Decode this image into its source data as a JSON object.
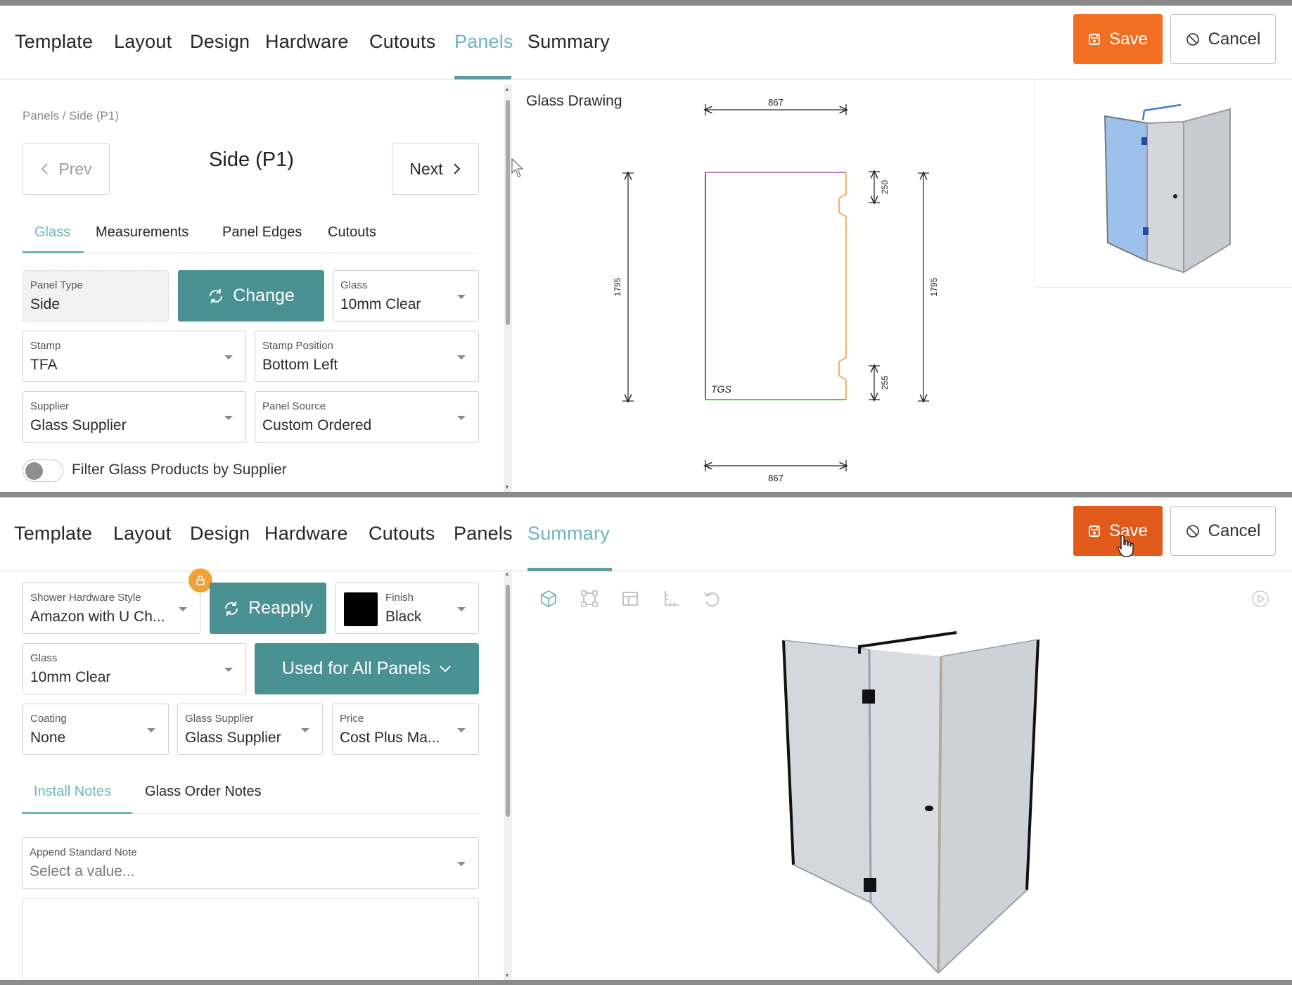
{
  "pane1": {
    "tabs": [
      "Template",
      "Layout",
      "Design",
      "Hardware",
      "Cutouts",
      "Panels",
      "Summary"
    ],
    "active_tab": "Panels",
    "save_label": "Save",
    "cancel_label": "Cancel",
    "breadcrumb": "Panels / Side (P1)",
    "prev_label": "Prev",
    "next_label": "Next",
    "panel_title": "Side (P1)",
    "subtabs": [
      "Glass",
      "Measurements",
      "Panel Edges",
      "Cutouts"
    ],
    "active_subtab": "Glass",
    "fields": {
      "panel_type": {
        "label": "Panel Type",
        "value": "Side"
      },
      "change_label": "Change",
      "glass": {
        "label": "Glass",
        "value": "10mm Clear"
      },
      "stamp": {
        "label": "Stamp",
        "value": "TFA"
      },
      "stamp_position": {
        "label": "Stamp Position",
        "value": "Bottom Left"
      },
      "supplier": {
        "label": "Supplier",
        "value": "Glass Supplier"
      },
      "panel_source": {
        "label": "Panel Source",
        "value": "Custom Ordered"
      }
    },
    "filter_toggle": {
      "label": "Filter Glass Products by Supplier",
      "on": false
    },
    "drawing": {
      "title": "Glass Drawing",
      "width_top": "867",
      "width_bottom": "867",
      "height_left": "1795",
      "height_right": "1795",
      "cutout_top": "250",
      "cutout_bottom": "255",
      "stamp_text": "TGS"
    }
  },
  "pane2": {
    "tabs": [
      "Template",
      "Layout",
      "Design",
      "Hardware",
      "Cutouts",
      "Panels",
      "Summary"
    ],
    "active_tab": "Summary",
    "save_label": "Save",
    "cancel_label": "Cancel",
    "fields": {
      "hardware_style": {
        "label": "Shower Hardware Style",
        "value": "Amazon with U Ch..."
      },
      "reapply_label": "Reapply",
      "finish": {
        "label": "Finish",
        "value": "Black",
        "swatch_color": "#000000"
      },
      "glass": {
        "label": "Glass",
        "value": "10mm Clear"
      },
      "used_for_label": "Used for All Panels",
      "coating": {
        "label": "Coating",
        "value": "None"
      },
      "glass_supplier": {
        "label": "Glass Supplier",
        "value": "Glass Supplier"
      },
      "price": {
        "label": "Price",
        "value": "Cost Plus Ma..."
      },
      "append_note": {
        "label": "Append Standard Note",
        "placeholder": "Select a value..."
      }
    },
    "subtabs": [
      "Install Notes",
      "Glass Order Notes"
    ],
    "active_subtab": "Install Notes"
  },
  "colors": {
    "accent_teal": "#6fb4b9",
    "button_teal": "#4a9194",
    "save_orange": "#f26e22",
    "lock_orange": "#f3a035"
  }
}
